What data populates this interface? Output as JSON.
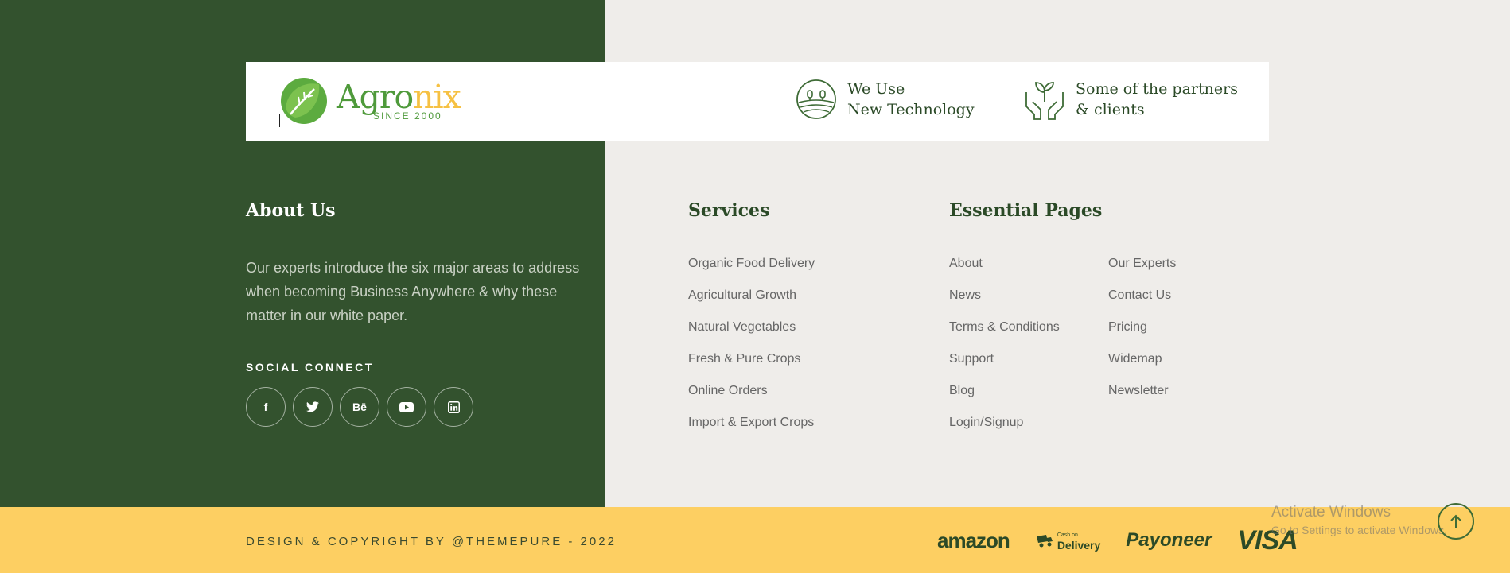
{
  "brand": {
    "name_main": "Agro",
    "name_accent": "nix",
    "since": "SINCE 2000",
    "colors": {
      "green": "#4f9a3b",
      "yellow": "#f6c143",
      "dark_green": "#33522e"
    }
  },
  "features": [
    {
      "icon": "farm-landscape-icon",
      "line1": "We Use",
      "line2": "New Technology"
    },
    {
      "icon": "hands-plant-icon",
      "line1": "Some of the partners",
      "line2": "& clients"
    }
  ],
  "about": {
    "title": "About Us",
    "text": "Our experts introduce the six major areas to address when becoming Business Anywhere & why these matter in our white paper.",
    "social_title": "SOCIAL CONNECT",
    "social": [
      {
        "icon": "facebook-icon",
        "label": "f"
      },
      {
        "icon": "twitter-icon",
        "label": ""
      },
      {
        "icon": "behance-icon",
        "label": "Bē"
      },
      {
        "icon": "youtube-icon",
        "label": ""
      },
      {
        "icon": "linkedin-icon",
        "label": "in"
      }
    ]
  },
  "services": {
    "title": "Services",
    "items": [
      "Organic Food Delivery",
      "Agricultural Growth",
      "Natural Vegetables",
      "Fresh & Pure Crops",
      "Online Orders",
      "Import & Export Crops"
    ]
  },
  "essential": {
    "title": "Essential Pages",
    "col1": [
      "About",
      "News",
      "Terms & Conditions",
      "Support",
      "Blog",
      "Login/Signup"
    ],
    "col2": [
      "Our Experts",
      "Contact Us",
      "Pricing",
      "Widemap",
      "Newsletter"
    ]
  },
  "footer": {
    "copyright": "DESIGN & COPYRIGHT BY @THEMEPURE - 2022",
    "payments": {
      "amazon": "amazon",
      "cod_small": "Cash on",
      "cod_big": "Delivery",
      "payoneer": "Payoneer",
      "visa": "VISA"
    }
  },
  "overlay": {
    "activate_title": "Activate Windows",
    "activate_sub": "Go to Settings to activate Windows."
  }
}
